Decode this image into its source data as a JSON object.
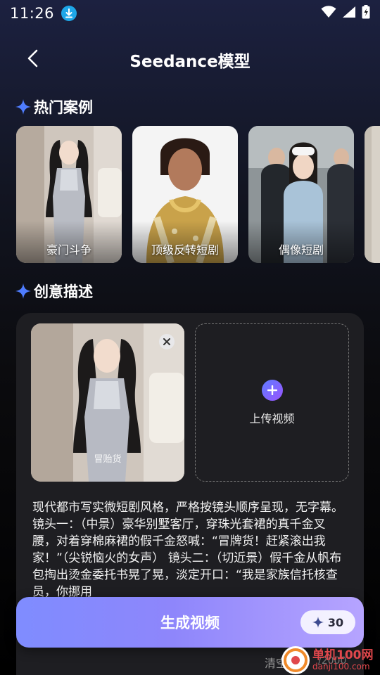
{
  "status_bar": {
    "time": "11:26"
  },
  "header": {
    "title": "Seedance模型"
  },
  "hot_cases": {
    "title": "热门案例",
    "items": [
      {
        "label": "豪门斗争"
      },
      {
        "label": "顶级反转短剧"
      },
      {
        "label": "偶像短剧"
      }
    ]
  },
  "creative": {
    "title": "创意描述",
    "reference_image_caption": "冒贻货",
    "upload_label": "上传视频",
    "prompt": "现代都市写实微短剧风格，严格按镜头顺序呈现，无字幕。 镜头一：（中景）豪华别墅客厅，穿珠光套裙的真千金叉腰，对着穿棉麻裙的假千金怒喊：“冒牌货！赶紧滚出我家！”（尖锐恼火的女声） 镜头二：（切近景）假千金从帆布包掏出烫金委托书晃了晃，淡定开口：“我是家族信托核查员，你挪用"
  },
  "actions": {
    "generate_label": "生成视频",
    "cost": "30",
    "clear_label": "清空",
    "char_count": "/2000"
  },
  "watermark": {
    "cn": "单机100网",
    "en": "danji100.com"
  },
  "colors": {
    "accent": "#7f8cff",
    "star": "#4f7dff",
    "badge_blue": "#1ea7e8"
  }
}
